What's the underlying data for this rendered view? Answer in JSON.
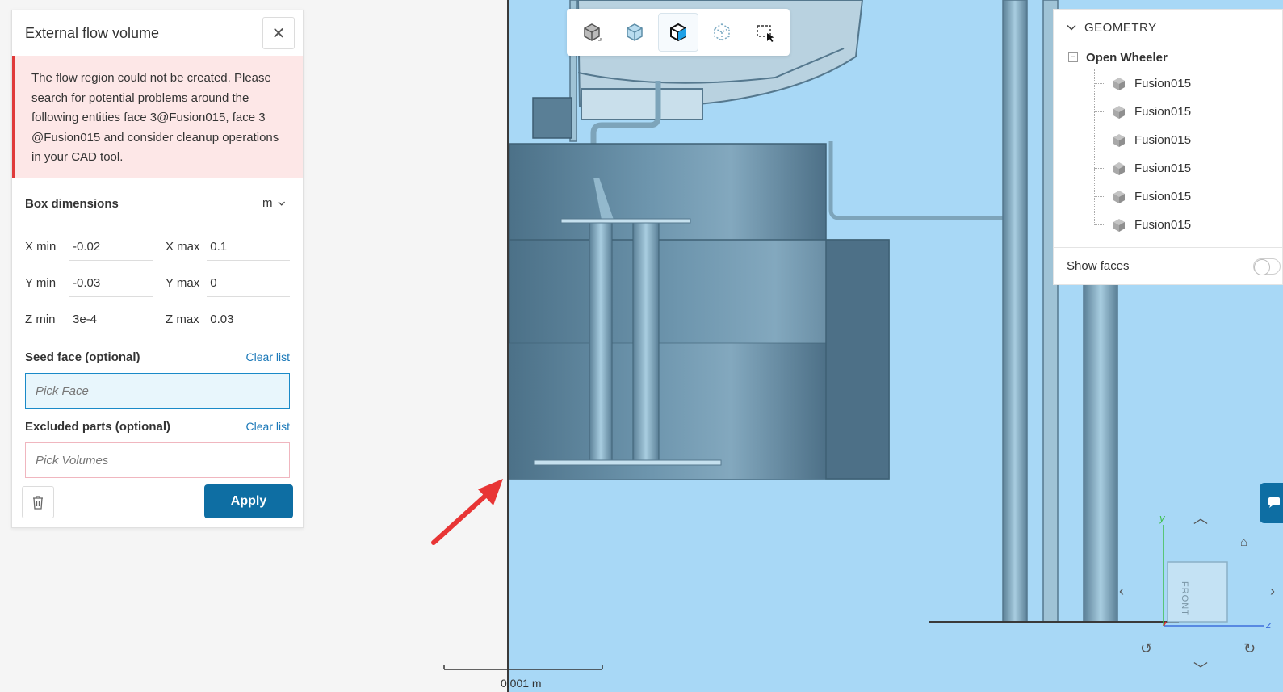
{
  "panel": {
    "title": "External flow volume",
    "error_message": "The flow region could not be created. Please search for potential problems around the following entities face 3@Fusion015, face 3 @Fusion015 and consider cleanup operations in your CAD tool.",
    "box_dimensions_label": "Box dimensions",
    "unit": "m",
    "dimensions": {
      "x_min_label": "X min",
      "x_min": "-0.02",
      "x_max_label": "X max",
      "x_max": "0.1",
      "y_min_label": "Y min",
      "y_min": "-0.03",
      "y_max_label": "Y max",
      "y_max": "0",
      "z_min_label": "Z min",
      "z_min": "3e-4",
      "z_max_label": "Z max",
      "z_max": "0.03"
    },
    "seed_face_label": "Seed face (optional)",
    "seed_face_clear": "Clear list",
    "seed_face_placeholder": "Pick Face",
    "excluded_label": "Excluded parts (optional)",
    "excluded_clear": "Clear list",
    "excluded_placeholder": "Pick Volumes",
    "apply_label": "Apply"
  },
  "tree": {
    "header": "GEOMETRY",
    "root": "Open Wheeler",
    "items": [
      "Fusion015",
      "Fusion015",
      "Fusion015",
      "Fusion015",
      "Fusion015",
      "Fusion015"
    ],
    "show_faces_label": "Show faces"
  },
  "scale_bar": {
    "label": "0.001 m"
  },
  "nav_cube": {
    "face_label": "FRONT",
    "axis_y": "y",
    "axis_z": "z"
  },
  "colors": {
    "accent": "#0e6ea3",
    "viewport_bg": "#a8d8f6",
    "error": "#e03a3a",
    "arrow": "#e83535"
  }
}
